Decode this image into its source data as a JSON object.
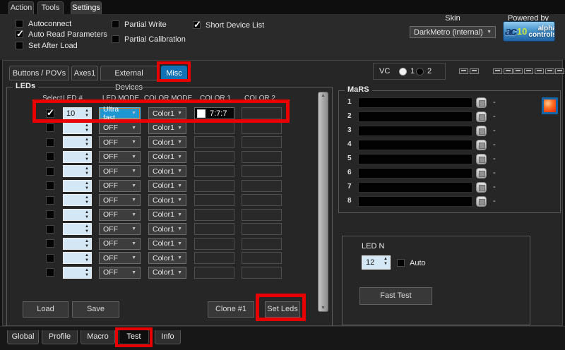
{
  "menu_tabs": [
    {
      "label": "Action",
      "active": false
    },
    {
      "label": "Tools",
      "active": false
    },
    {
      "label": "Settings",
      "active": true
    }
  ],
  "settings": {
    "checkboxes": [
      {
        "label": "Autoconnect",
        "checked": false
      },
      {
        "label": "Auto Read Parameters",
        "checked": true
      },
      {
        "label": "Set After Load",
        "checked": false
      },
      {
        "label": "Partial Write",
        "checked": false
      },
      {
        "label": "Partial Calibration",
        "checked": false
      },
      {
        "label": "Short Device List",
        "checked": true
      }
    ],
    "skin_label": "Skin",
    "skin_value": "DarkMetro (internal)",
    "powered_by": "Powered by",
    "logo": {
      "ac": "ac",
      "num": "10",
      "line1": "alpha",
      "line2": "controls"
    }
  },
  "device_tabs": [
    {
      "label": "Buttons / POVs",
      "active": false
    },
    {
      "label": "Axes1",
      "active": false
    },
    {
      "label": "External Devices",
      "active": false
    },
    {
      "label": "Misc",
      "active": true,
      "annotated": true
    }
  ],
  "vc": {
    "label": "VC",
    "options": [
      {
        "label": "1",
        "selected": true
      },
      {
        "label": "2",
        "selected": false
      }
    ]
  },
  "indicator_dashes": {
    "group1_count": 2,
    "group2_count": 7
  },
  "leds": {
    "title": "LEDs",
    "columns": [
      "Select",
      "LED #",
      "LED MODE",
      "COLOR MODE",
      "COLOR 1",
      "COLOR 2"
    ],
    "rows": [
      {
        "selected": true,
        "led_num": "10",
        "led_mode": "Ultra fast",
        "color_mode": "Color1",
        "color1": "7:7:7",
        "color1_swatch": "#ffffff",
        "color2": "",
        "highlighted": true
      },
      {
        "selected": false,
        "led_num": "",
        "led_mode": "OFF",
        "color_mode": "Color1",
        "color1": "",
        "color2": ""
      },
      {
        "selected": false,
        "led_num": "",
        "led_mode": "OFF",
        "color_mode": "Color1",
        "color1": "",
        "color2": ""
      },
      {
        "selected": false,
        "led_num": "",
        "led_mode": "OFF",
        "color_mode": "Color1",
        "color1": "",
        "color2": ""
      },
      {
        "selected": false,
        "led_num": "",
        "led_mode": "OFF",
        "color_mode": "Color1",
        "color1": "",
        "color2": ""
      },
      {
        "selected": false,
        "led_num": "",
        "led_mode": "OFF",
        "color_mode": "Color1",
        "color1": "",
        "color2": ""
      },
      {
        "selected": false,
        "led_num": "",
        "led_mode": "OFF",
        "color_mode": "Color1",
        "color1": "",
        "color2": ""
      },
      {
        "selected": false,
        "led_num": "",
        "led_mode": "OFF",
        "color_mode": "Color1",
        "color1": "",
        "color2": ""
      },
      {
        "selected": false,
        "led_num": "",
        "led_mode": "OFF",
        "color_mode": "Color1",
        "color1": "",
        "color2": ""
      },
      {
        "selected": false,
        "led_num": "",
        "led_mode": "OFF",
        "color_mode": "Color1",
        "color1": "",
        "color2": ""
      },
      {
        "selected": false,
        "led_num": "",
        "led_mode": "OFF",
        "color_mode": "Color1",
        "color1": "",
        "color2": ""
      },
      {
        "selected": false,
        "led_num": "",
        "led_mode": "OFF",
        "color_mode": "Color1",
        "color1": "",
        "color2": ""
      }
    ],
    "buttons": {
      "load": "Load",
      "save": "Save",
      "clone": "Clone #1",
      "set_leds": "Set Leds"
    }
  },
  "mars": {
    "title": "MaRS",
    "rows": [
      {
        "num": "1",
        "value": "",
        "suffix": "-"
      },
      {
        "num": "2",
        "value": "",
        "suffix": "-"
      },
      {
        "num": "3",
        "value": "",
        "suffix": "-"
      },
      {
        "num": "4",
        "value": "",
        "suffix": "-"
      },
      {
        "num": "5",
        "value": "",
        "suffix": "-"
      },
      {
        "num": "6",
        "value": "",
        "suffix": "-"
      },
      {
        "num": "7",
        "value": "",
        "suffix": "-"
      },
      {
        "num": "8",
        "value": "",
        "suffix": "-"
      }
    ]
  },
  "led_n": {
    "label": "LED N",
    "value": "12",
    "auto_label": "Auto",
    "auto_checked": false,
    "fast_test": "Fast Test"
  },
  "bottom_tabs": [
    {
      "label": "Global",
      "active": false
    },
    {
      "label": "Profile",
      "active": false
    },
    {
      "label": "Macro",
      "active": false
    },
    {
      "label": "Test",
      "active": true,
      "annotated": true
    },
    {
      "label": "Info",
      "active": false
    }
  ],
  "icons": {
    "dropdown_arrow": "▼",
    "spinner_up": "▲",
    "spinner_down": "▼",
    "checkmark": "✓"
  },
  "colors": {
    "annotation_red": "#e80000",
    "active_tab_blue": "#1173b6",
    "selected_mode_blue": "#1f97d3",
    "spinner_bg": "#d4e7f5",
    "color1_swatch": "#ffffff",
    "orange_button": "#ee3c0e"
  }
}
